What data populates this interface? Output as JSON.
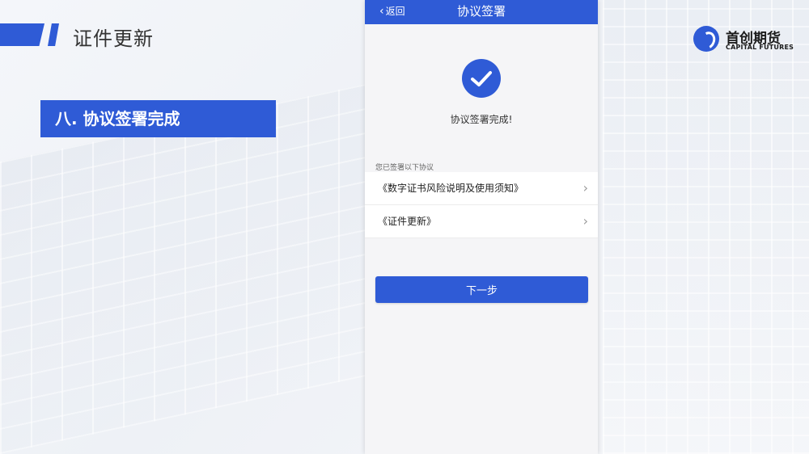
{
  "slide": {
    "title": "证件更新",
    "step_label": "八. 协议签署完成"
  },
  "logo": {
    "name_cn": "首创期货",
    "name_en": "CAPITAL FUTURES"
  },
  "phone": {
    "nav": {
      "back_label": "返回",
      "title": "协议签署"
    },
    "status_icon": "check-circle-icon",
    "status_text": "协议签署完成!",
    "section_label": "您已签署以下协议",
    "agreements": [
      {
        "label": "《数字证书风险说明及使用须知》"
      },
      {
        "label": "《证件更新》"
      }
    ],
    "next_button": "下一步"
  },
  "colors": {
    "accent": "#2f5bd6",
    "phone_bg": "#f5f5f7"
  }
}
